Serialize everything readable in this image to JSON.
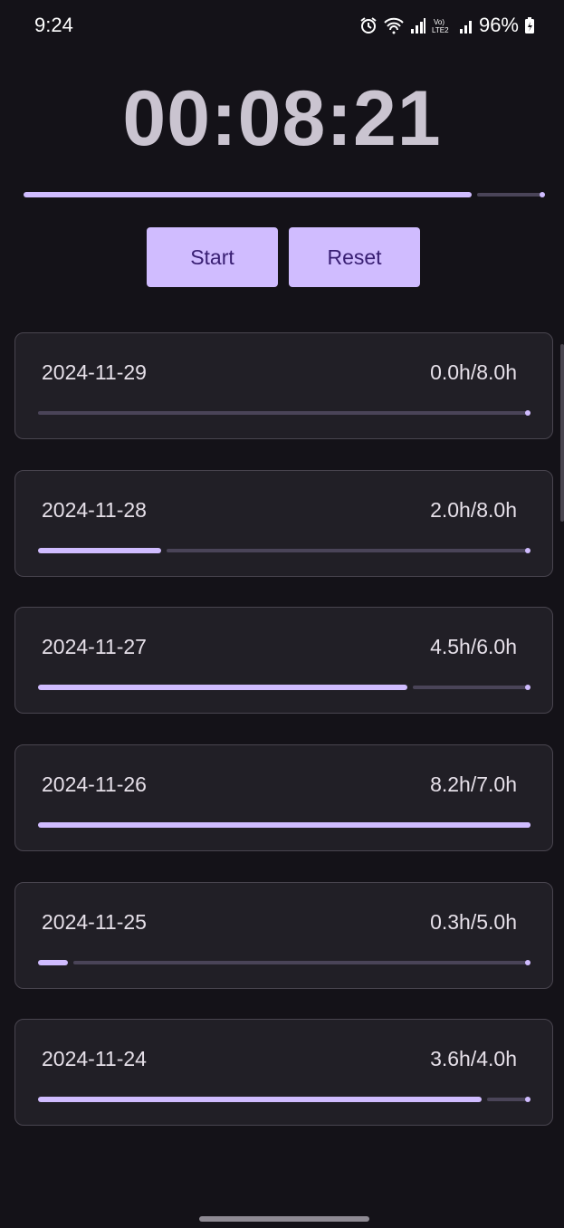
{
  "status_bar": {
    "time": "9:24",
    "icons": [
      "alarm-icon",
      "wifi-icon",
      "signal-icon",
      "volte-icon",
      "signal-icon-2",
      "battery-charging-icon"
    ],
    "battery": "96%",
    "network": "LTE2"
  },
  "timer": {
    "display": "00:08:21",
    "progress": 0.86
  },
  "buttons": {
    "start_label": "Start",
    "reset_label": "Reset"
  },
  "entries": [
    {
      "date": "2024-11-29",
      "hours": "0.0h/8.0h",
      "progress": 0.0
    },
    {
      "date": "2024-11-28",
      "hours": "2.0h/8.0h",
      "progress": 0.25
    },
    {
      "date": "2024-11-27",
      "hours": "4.5h/6.0h",
      "progress": 0.75
    },
    {
      "date": "2024-11-26",
      "hours": "8.2h/7.0h",
      "progress": 1.0
    },
    {
      "date": "2024-11-25",
      "hours": "0.3h/5.0h",
      "progress": 0.06
    },
    {
      "date": "2024-11-24",
      "hours": "3.6h/4.0h",
      "progress": 0.9
    }
  ],
  "colors": {
    "background": "#141218",
    "accent": "#d0bcff",
    "track": "#4a4458",
    "card": "#211f26",
    "button_text": "#381e72"
  }
}
